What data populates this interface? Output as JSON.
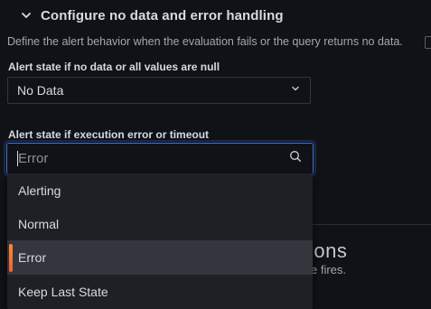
{
  "section": {
    "title": "Configure no data and error handling"
  },
  "description": "Define the alert behavior when the evaluation fails or the query returns no data.",
  "no_data": {
    "label": "Alert state if no data or all values are null",
    "value": "No Data"
  },
  "exec_error": {
    "label": "Alert state if execution error or timeout",
    "placeholder": "Error",
    "options": [
      "Alerting",
      "Normal",
      "Error",
      "Keep Last State"
    ],
    "selected": "Error"
  },
  "background": {
    "heading_fragment": "ions",
    "sub_fragment": "e fires."
  },
  "colors": {
    "accent": "#3d71d9",
    "selected_bar": "#ff8833"
  }
}
